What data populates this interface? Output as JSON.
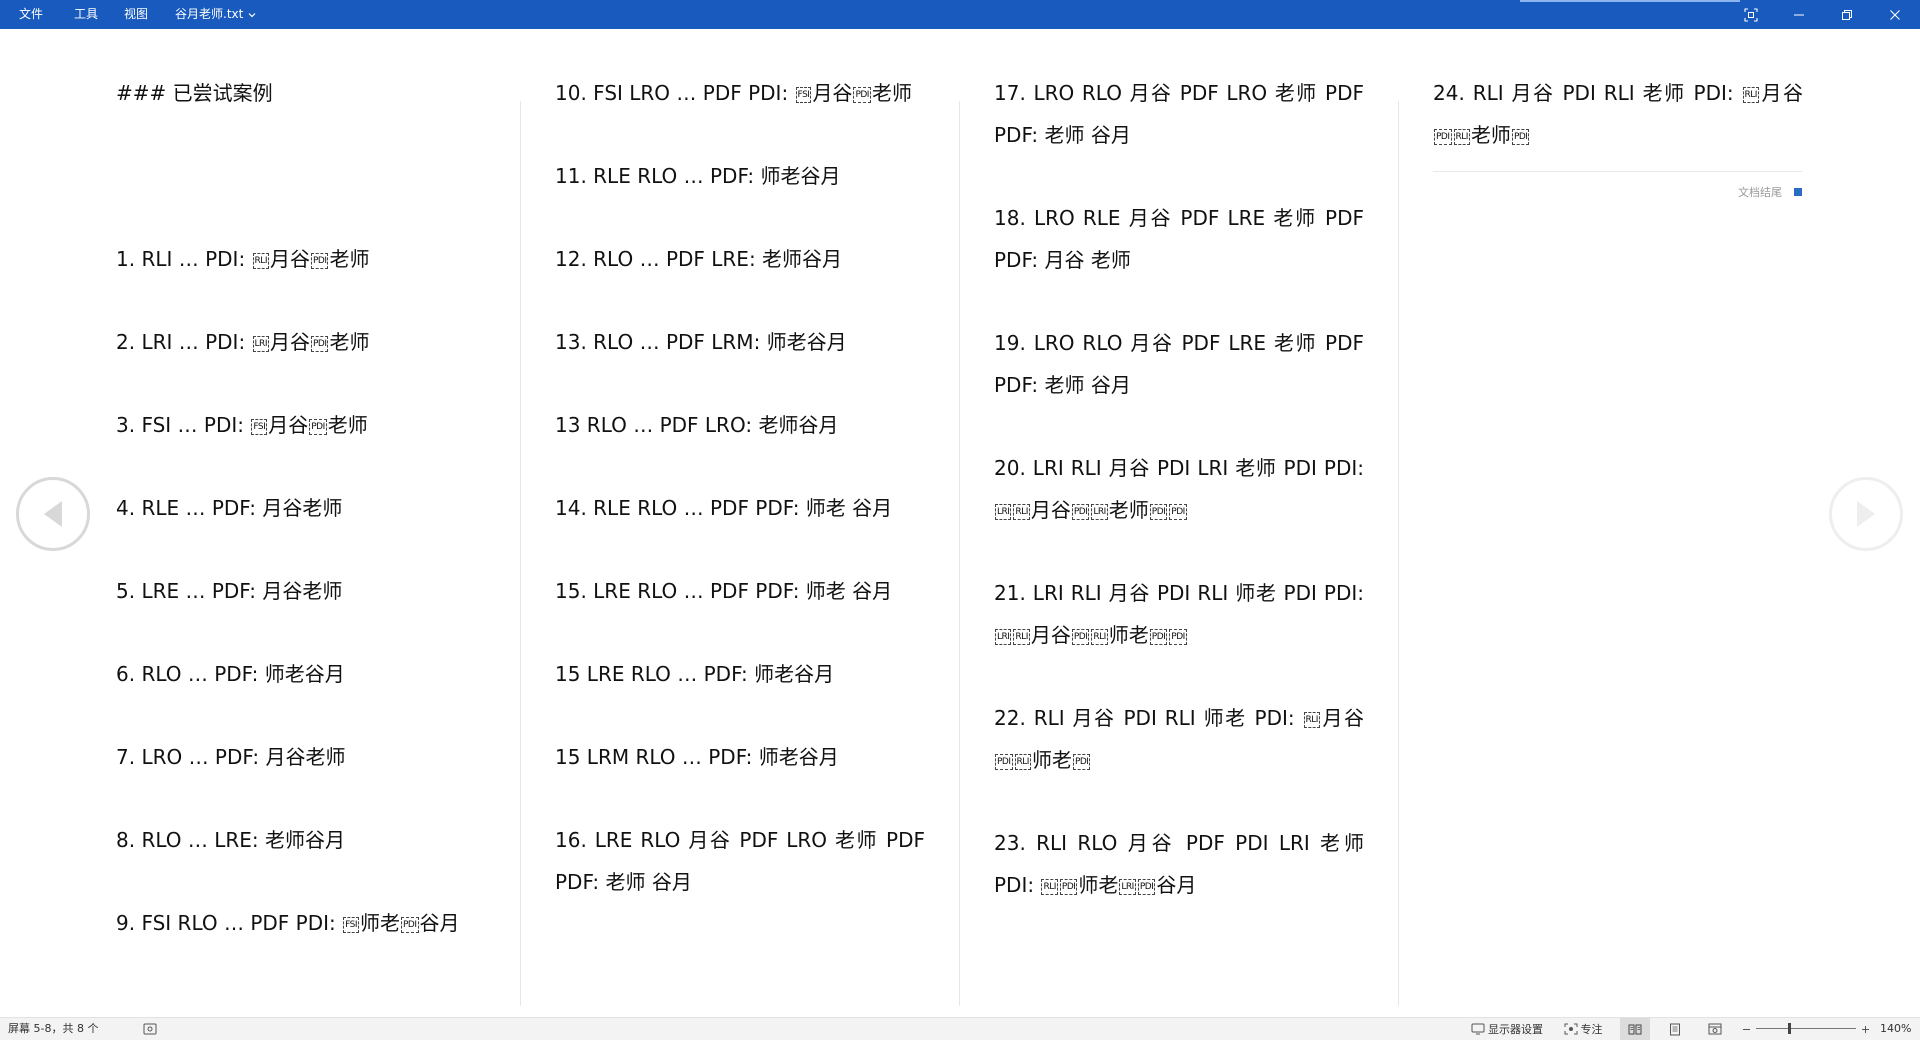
{
  "menu": {
    "file": "文件",
    "tools": "工具",
    "view": "视图",
    "doc_title": "谷月老师.txt"
  },
  "window": {
    "icons": [
      "fullscreen-icon",
      "minimize-icon",
      "restore-icon",
      "close-icon"
    ]
  },
  "columns": [
    [
      {
        "type": "text",
        "parts": [
          {
            "t": "###  已尝试案例"
          }
        ]
      },
      {
        "type": "gap"
      },
      {
        "type": "text",
        "parts": [
          {
            "t": "1. RLI … PDI: "
          },
          {
            "c": "RLI"
          },
          {
            "t": "月谷"
          },
          {
            "c": "PDI"
          },
          {
            "t": "老师"
          }
        ]
      },
      {
        "type": "text",
        "parts": [
          {
            "t": "2. LRI … PDI: "
          },
          {
            "c": "LRI"
          },
          {
            "t": "月谷"
          },
          {
            "c": "PDI"
          },
          {
            "t": "老师"
          }
        ]
      },
      {
        "type": "text",
        "parts": [
          {
            "t": "3. FSI … PDI: "
          },
          {
            "c": "FSI"
          },
          {
            "t": "月谷"
          },
          {
            "c": "PDI"
          },
          {
            "t": "老师"
          }
        ]
      },
      {
        "type": "text",
        "parts": [
          {
            "t": "4. RLE … PDF:  月谷老师"
          }
        ]
      },
      {
        "type": "text",
        "parts": [
          {
            "t": "5. LRE … PDF:  月谷老师"
          }
        ]
      },
      {
        "type": "text",
        "parts": [
          {
            "t": "6. RLO … PDF:  师老谷月"
          }
        ]
      },
      {
        "type": "text",
        "parts": [
          {
            "t": "7. LRO … PDF:  月谷老师"
          }
        ]
      },
      {
        "type": "text",
        "parts": [
          {
            "t": "8. RLO … LRE:  老师谷月"
          }
        ]
      },
      {
        "type": "text",
        "parts": [
          {
            "t": "9. FSI RLO … PDF PDI: "
          },
          {
            "c": "FSI"
          },
          {
            "t": "师老"
          },
          {
            "c": "PDI"
          },
          {
            "t": "谷月"
          }
        ]
      }
    ],
    [
      {
        "type": "text",
        "parts": [
          {
            "t": "10. FSI LRO … PDF PDI: "
          },
          {
            "c": "FSI"
          },
          {
            "t": "月谷"
          },
          {
            "c": "PDI"
          },
          {
            "t": "老师"
          }
        ]
      },
      {
        "type": "text",
        "parts": [
          {
            "t": "11. RLE RLO … PDF:  师老谷月"
          }
        ]
      },
      {
        "type": "text",
        "parts": [
          {
            "t": "12. RLO … PDF LRE:  老师谷月"
          }
        ]
      },
      {
        "type": "text",
        "parts": [
          {
            "t": "13. RLO … PDF LRM:  师老谷月"
          }
        ]
      },
      {
        "type": "text",
        "parts": [
          {
            "t": "13 RLO … PDF LRO:  老师谷月"
          }
        ]
      },
      {
        "type": "text",
        "parts": [
          {
            "t": "14. RLE RLO … PDF PDF:  师老      谷月"
          }
        ]
      },
      {
        "type": "text",
        "parts": [
          {
            "t": "15. LRE RLO … PDF PDF:  师老      谷月"
          }
        ]
      },
      {
        "type": "text",
        "parts": [
          {
            "t": "15 LRE RLO … PDF:  师老谷月"
          }
        ]
      },
      {
        "type": "text",
        "parts": [
          {
            "t": "15 LRM RLO … PDF: 师老谷月"
          }
        ]
      },
      {
        "type": "wrap",
        "parts": [
          {
            "t": "16.  LRE  RLO  月谷  PDF  LRO  老师  PDF  PDF:  老师    谷月"
          }
        ]
      }
    ],
    [
      {
        "type": "wrap",
        "parts": [
          {
            "t": "17.  LRO  RLO  月谷  PDF  LRO  老师  PDF  PDF:  老师    谷月"
          }
        ]
      },
      {
        "type": "wrap",
        "parts": [
          {
            "t": "18.  LRO  RLE  月谷  PDF  LRE  老师  PDF  PDF:  月谷    老师"
          }
        ]
      },
      {
        "type": "wrap",
        "parts": [
          {
            "t": "19.  LRO  RLO  月谷  PDF  LRE  老师  PDF  PDF:  老师    谷月"
          }
        ]
      },
      {
        "type": "wrap",
        "parts": [
          {
            "t": "20.  LRI  RLI  月谷  PDI  LRI  老师  PDI  PDI: "
          },
          {
            "c": "LRI"
          },
          {
            "c": "RLI"
          },
          {
            "t": "月谷"
          },
          {
            "c": "PDI"
          },
          {
            "c": "LRI"
          },
          {
            "t": "老师"
          },
          {
            "c": "PDI"
          },
          {
            "c": "PDI"
          }
        ]
      },
      {
        "type": "wrap",
        "parts": [
          {
            "t": "21.  LRI  RLI  月谷  PDI  RLI  师老  PDI  PDI: "
          },
          {
            "c": "LRI"
          },
          {
            "c": "RLI"
          },
          {
            "t": "月谷"
          },
          {
            "c": "PDI"
          },
          {
            "c": "RLI"
          },
          {
            "t": "师老"
          },
          {
            "c": "PDI"
          },
          {
            "c": "PDI"
          }
        ]
      },
      {
        "type": "wrap",
        "parts": [
          {
            "t": "22.  RLI  月谷  PDI  RLI  师老  PDI: "
          },
          {
            "c": "RLI"
          },
          {
            "t": "月谷 "
          },
          {
            "c": "PDI"
          },
          {
            "c": "RLI"
          },
          {
            "t": "师老"
          },
          {
            "c": "PDI"
          }
        ]
      },
      {
        "type": "wrap",
        "parts": [
          {
            "t": "23.  RLI  RLO  月谷  PDF  PDI  LRI  老师  PDI: "
          },
          {
            "c": "RLI"
          },
          {
            "c": "PDI"
          },
          {
            "t": "师老"
          },
          {
            "c": "LRI"
          },
          {
            "c": "PDI"
          },
          {
            "t": "谷月"
          }
        ]
      }
    ],
    [
      {
        "type": "wrap",
        "parts": [
          {
            "t": "24.  RLI  月谷  PDI  RLI  老师  PDI: "
          },
          {
            "c": "RLI"
          },
          {
            "t": "月谷 "
          },
          {
            "c": "PDI"
          },
          {
            "c": "RLI"
          },
          {
            "t": "老师"
          },
          {
            "c": "PDI"
          }
        ]
      }
    ]
  ],
  "doc_end_label": "文档结尾",
  "status": {
    "page_info": "屏幕 5-8，共 8 个",
    "display_settings": "显示器设置",
    "focus": "专注",
    "zoom_level": "140%",
    "zoom_fraction": 0.33
  },
  "colors": {
    "titlebar": "#185abd",
    "accent": "#2b6cc4"
  }
}
